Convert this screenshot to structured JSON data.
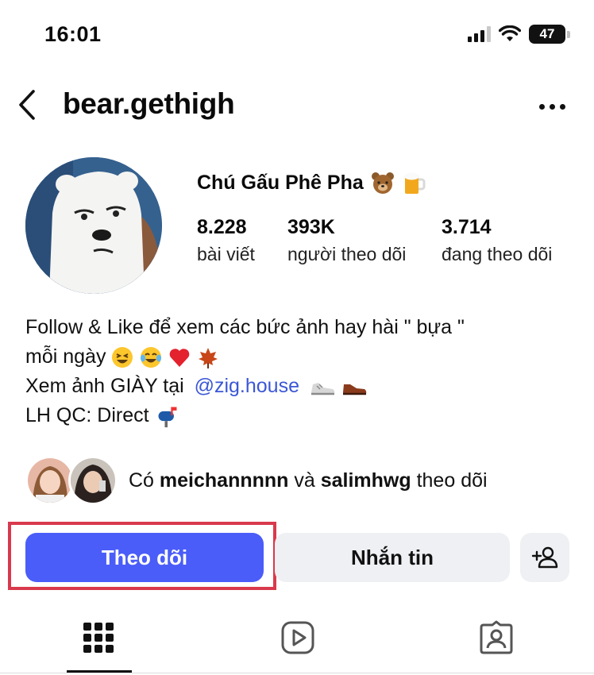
{
  "status_bar": {
    "time": "16:01",
    "battery": "47"
  },
  "header": {
    "username": "bear.gethigh"
  },
  "profile": {
    "display_name": "Chú Gấu Phê Pha",
    "stats": [
      {
        "value": "8.228",
        "label": "bài viết"
      },
      {
        "value": "393K",
        "label": "người theo dõi"
      },
      {
        "value": "3.714",
        "label": "đang theo dõi"
      }
    ]
  },
  "bio": {
    "line1": "Follow & Like để xem các bức ảnh hay hài \" bựa \"",
    "line2": "mỗi ngày",
    "line3_prefix": "Xem ảnh GIÀY tại ",
    "line3_mention": "@zig.house",
    "line4": "LH QC: Direct"
  },
  "followed_by": {
    "prefix": "Có ",
    "user1": "meichannnnn",
    "connector": " và ",
    "user2": "salimhwg",
    "suffix": " theo dõi"
  },
  "actions": {
    "follow_label": "Theo dõi",
    "message_label": "Nhắn tin"
  },
  "colors": {
    "accent": "#4a5df9",
    "highlight": "#d9394c",
    "mention": "#3b57d6",
    "secondary_button": "#eef0f3"
  },
  "icons": [
    "signal-icon",
    "wifi-icon",
    "battery-icon",
    "back-chevron-icon",
    "more-dots-icon",
    "bear-emoji-icon",
    "beer-emoji-icon",
    "laughing-emoji-icon",
    "tears-of-joy-emoji-icon",
    "heart-emoji-icon",
    "maple-leaf-emoji-icon",
    "sneaker-emoji-icon",
    "shoe-emoji-icon",
    "mailbox-emoji-icon",
    "add-person-icon",
    "grid-icon",
    "reels-icon",
    "tagged-icon"
  ]
}
